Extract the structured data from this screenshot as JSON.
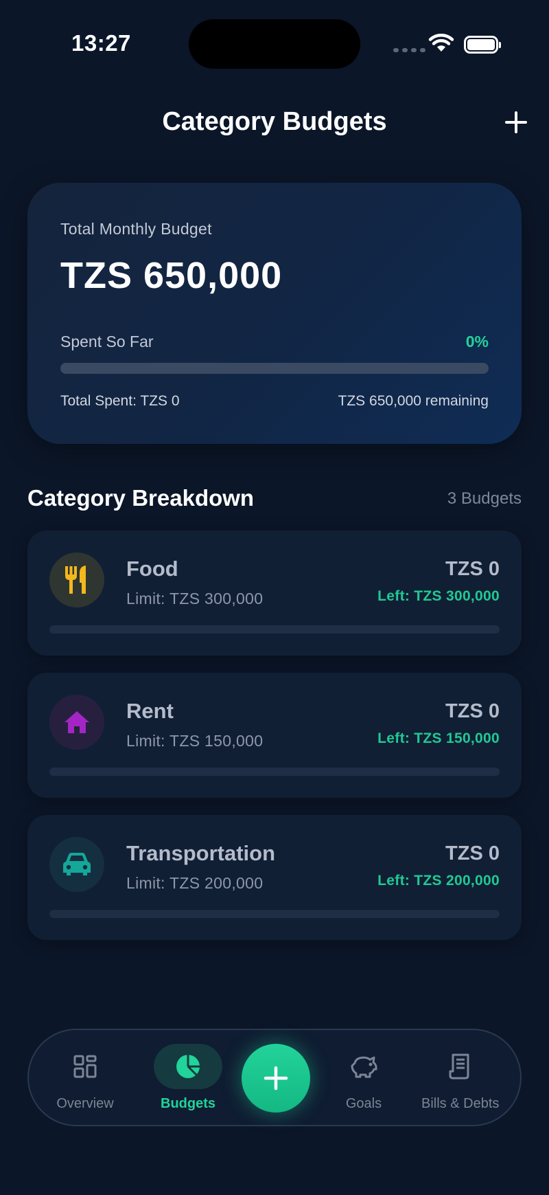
{
  "status_bar": {
    "time": "13:27"
  },
  "header": {
    "title": "Category Budgets"
  },
  "summary": {
    "label": "Total Monthly Budget",
    "amount": "TZS 650,000",
    "spent_label": "Spent So Far",
    "spent_percent_text": "0%",
    "progress": 0,
    "total_spent": "Total Spent: TZS 0",
    "remaining": "TZS 650,000 remaining"
  },
  "breakdown": {
    "title": "Category Breakdown",
    "count": "3 Budgets",
    "items": [
      {
        "name": "Food",
        "limit": "Limit: TZS 300,000",
        "spent": "TZS 0",
        "left": "Left: TZS 300,000",
        "icon": "fork-knife-icon",
        "icon_color": "#f4b81c",
        "icon_bg": "#2f3531",
        "progress": 0
      },
      {
        "name": "Rent",
        "limit": "Limit: TZS 150,000",
        "spent": "TZS 0",
        "left": "Left: TZS 150,000",
        "icon": "house-icon",
        "icon_color": "#a326c4",
        "icon_bg": "#26203e",
        "progress": 0
      },
      {
        "name": "Transportation",
        "limit": "Limit: TZS 200,000",
        "spent": "TZS 0",
        "left": "Left: TZS 200,000",
        "icon": "car-icon",
        "icon_color": "#15a89a",
        "icon_bg": "#143040",
        "progress": 0
      }
    ]
  },
  "nav": {
    "items": [
      {
        "label": "Overview",
        "icon": "grid-icon"
      },
      {
        "label": "Budgets",
        "icon": "pie-chart-icon"
      },
      {
        "label": "Goals",
        "icon": "piggy-bank-icon"
      },
      {
        "label": "Bills & Debts",
        "icon": "receipt-icon"
      }
    ],
    "fab_icon": "plus-icon"
  },
  "colors": {
    "accent": "#22d39a",
    "background": "#0b1628",
    "card": "#111f35"
  }
}
